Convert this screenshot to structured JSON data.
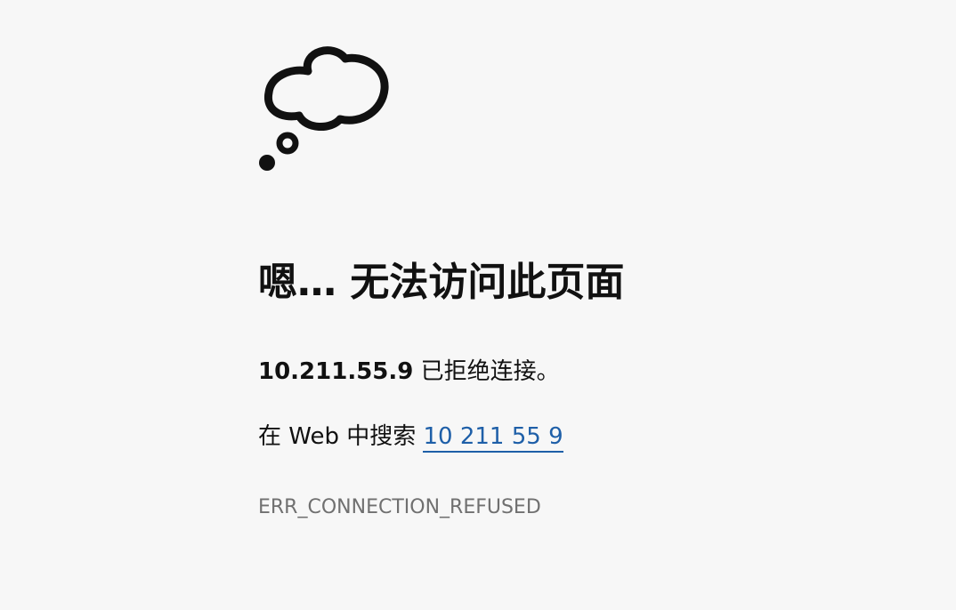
{
  "error": {
    "icon": "thought-bubble-icon",
    "title": "嗯… 无法访问此页面",
    "host": "10.211.55.9",
    "message": "已拒绝连接。",
    "search_prefix": "在 Web 中搜索",
    "search_link": "10 211 55 9",
    "code": "ERR_CONNECTION_REFUSED"
  },
  "colors": {
    "background": "#f7f7f7",
    "text": "#111111",
    "link": "#1e5fa8",
    "code": "#707070"
  }
}
